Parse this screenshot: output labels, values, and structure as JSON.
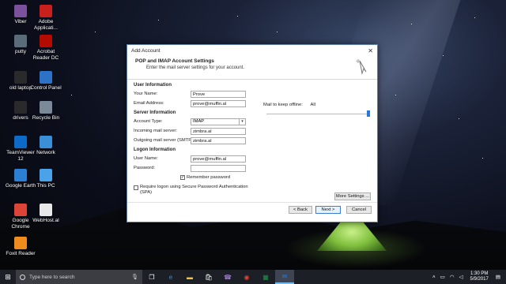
{
  "desktop": {
    "icons": [
      {
        "label": "Viber",
        "icon": "viber-icon",
        "color": "#7b519d"
      },
      {
        "label": "Adobe Applicati...",
        "icon": "adobe-icon",
        "color": "#c8201c"
      },
      {
        "label": "putty",
        "icon": "putty-icon",
        "color": "#5a6b7a"
      },
      {
        "label": "Acrobat Reader DC",
        "icon": "acrobat-icon",
        "color": "#b30b00"
      },
      {
        "label": "old laptop",
        "icon": "folder-icon",
        "color": "#2a2a2a"
      },
      {
        "label": "Control Panel",
        "icon": "control-panel-icon",
        "color": "#2c73c8"
      },
      {
        "label": "drivers",
        "icon": "drivers-icon",
        "color": "#2a2a2a"
      },
      {
        "label": "Recycle Bin",
        "icon": "recycle-bin-icon",
        "color": "#7a8a99"
      },
      {
        "label": "TeamViewer 12",
        "icon": "teamviewer-icon",
        "color": "#0e6ac7"
      },
      {
        "label": "Network",
        "icon": "network-icon",
        "color": "#3b8fd6"
      },
      {
        "label": "Google Earth",
        "icon": "google-earth-icon",
        "color": "#2b7fd4"
      },
      {
        "label": "This PC",
        "icon": "this-pc-icon",
        "color": "#4aa3e8"
      },
      {
        "label": "Google Chrome",
        "icon": "chrome-icon",
        "color": "#db4437"
      },
      {
        "label": "WebHost.al",
        "icon": "file-icon",
        "color": "#e8e8e8"
      },
      {
        "label": "Foxit Reader",
        "icon": "foxit-icon",
        "color": "#f08c1e"
      }
    ]
  },
  "dialog": {
    "window_title": "Add Account",
    "close_glyph": "✕",
    "header_title": "POP and IMAP Account Settings",
    "header_subtitle": "Enter the mail server settings for your account.",
    "user_info_heading": "User Information",
    "your_name_label": "Your Name:",
    "your_name_value": "Prove",
    "email_label": "Email Address:",
    "email_value": "prove@muffin.al",
    "server_info_heading": "Server Information",
    "account_type_label": "Account Type:",
    "account_type_value": "IMAP",
    "incoming_label": "Incoming mail server:",
    "incoming_value": "zimbra.al",
    "outgoing_label": "Outgoing mail server (SMTP):",
    "outgoing_value": "zimbra.al",
    "logon_heading": "Logon Information",
    "username_label": "User Name:",
    "username_value": "prove@muffin.al",
    "password_label": "Password:",
    "password_value": "",
    "remember_label": "Remember password",
    "remember_checked": true,
    "spa_label_1": "Require logon using Secure Password Authentication",
    "spa_label_2": "(SPA)",
    "spa_checked": false,
    "mail_offline_label": "Mail to keep offline:",
    "mail_offline_value": "All",
    "more_settings_label": "More Settings ...",
    "back_label": "< Back",
    "next_label": "Next >",
    "cancel_label": "Cancel"
  },
  "taskbar": {
    "search_placeholder": "Type here to search",
    "time": "1:30 PM",
    "date": "5/9/2017",
    "accent_color": "#76b9ed",
    "pinned": [
      "task-view-icon",
      "edge-icon",
      "file-explorer-icon",
      "store-icon",
      "viber-icon",
      "chrome-icon",
      "excel-icon",
      "outlook-icon"
    ]
  }
}
